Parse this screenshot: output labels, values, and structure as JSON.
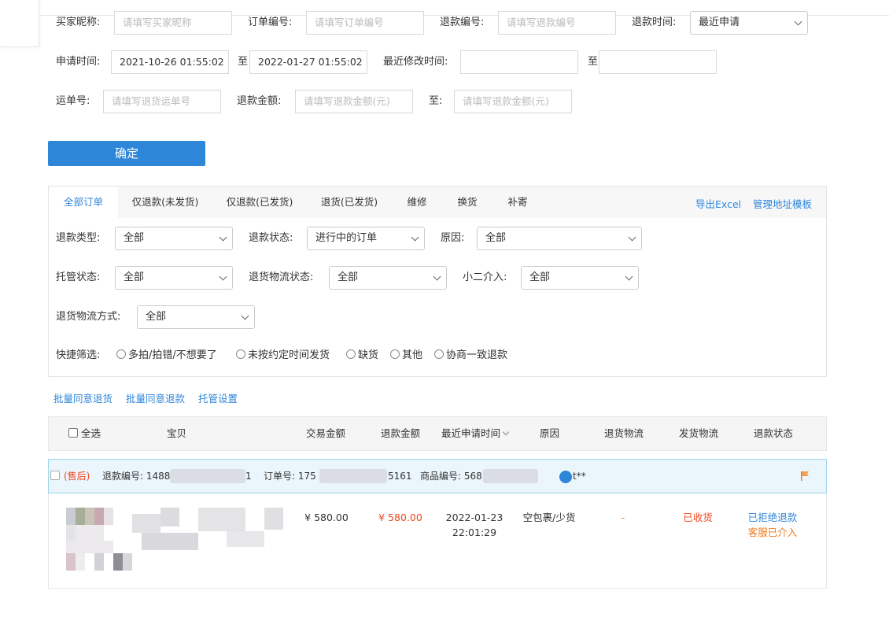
{
  "filters": {
    "buyer_nick": {
      "label": "买家昵称:",
      "placeholder": "请填写买家昵称"
    },
    "order_no": {
      "label": "订单编号:",
      "placeholder": "请填写订单编号"
    },
    "refund_no": {
      "label": "退款编号:",
      "placeholder": "请填写退款编号"
    },
    "refund_time": {
      "label": "退款时间:",
      "value": "最近申请"
    },
    "apply_time": {
      "label": "申请时间:",
      "from": "2021-10-26 01:55:02",
      "to_label": "至",
      "to": "2022-01-27 01:55:02"
    },
    "modify_time": {
      "label": "最近修改时间:",
      "from": "",
      "to_label": "至",
      "to": ""
    },
    "waybill": {
      "label": "运单号:",
      "placeholder": "请填写退货运单号"
    },
    "refund_amount": {
      "label": "退款金额:",
      "placeholder": "请填写退款金额(元)",
      "to_label": "至:",
      "to_placeholder": "请填写退款金额(元)"
    },
    "confirm_label": "确定"
  },
  "tabs": [
    "全部订单",
    "仅退款(未发货)",
    "仅退款(已发货)",
    "退货(已发货)",
    "维修",
    "换货",
    "补寄"
  ],
  "tab_links": {
    "export": "导出Excel",
    "address": "管理地址模板"
  },
  "panel": {
    "refund_type": {
      "label": "退款类型:",
      "value": "全部"
    },
    "refund_status": {
      "label": "退款状态:",
      "value": "进行中的订单"
    },
    "reason": {
      "label": "原因:",
      "value": "全部"
    },
    "custody_status": {
      "label": "托管状态:",
      "value": "全部"
    },
    "return_logistics_status": {
      "label": "退货物流状态:",
      "value": "全部"
    },
    "xiaoer": {
      "label": "小二介入:",
      "value": "全部"
    },
    "return_logistics_method": {
      "label": "退货物流方式:",
      "value": "全部"
    },
    "quick_filter": {
      "label": "快捷筛选:",
      "options": [
        "多拍/拍错/不想要了",
        "未按约定时间发货",
        "缺货",
        "其他",
        "协商一致退款"
      ]
    }
  },
  "bulk": {
    "agree_return": "批量同意退货",
    "agree_refund": "批量同意退款",
    "custody": "托管设置"
  },
  "table": {
    "headers": {
      "select_all": "全选",
      "item": "宝贝",
      "trade_amount": "交易金额",
      "refund_amount": "退款金额",
      "apply_time": "最近申请时间",
      "reason": "原因",
      "return_logistics": "退货物流",
      "ship_logistics": "发货物流",
      "refund_status": "退款状态"
    },
    "order": {
      "tag": "(售后)",
      "refund_no_label": "退款编号:",
      "refund_no_head": "1488",
      "refund_no_tail": "1",
      "order_no_label": "订单号:",
      "order_no_head": "175",
      "order_no_tail": "5161",
      "item_no_label": "商品编号:",
      "item_no_head": "568",
      "buyer_tail": "t**"
    },
    "row": {
      "trade_amount": "¥ 580.00",
      "refund_amount": "¥ 580.00",
      "apply_date": "2022-01-23",
      "apply_clock": "22:01:29",
      "reason": "空包裹/少货",
      "return_logistics": "-",
      "ship_logistics": "已收货",
      "status": "已拒绝退款",
      "status_sub": "客服已介入"
    }
  },
  "colors": {
    "accent": "#2e86d9",
    "red": "#f0481e",
    "orange": "#f07a1e"
  }
}
